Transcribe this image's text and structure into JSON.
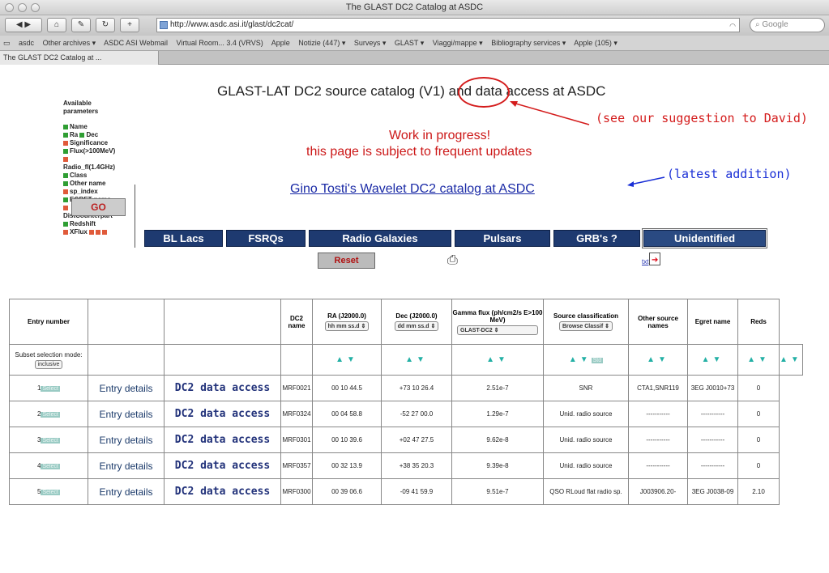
{
  "browser": {
    "window_title": "The GLAST DC2 Catalog at ASDC",
    "url": "http://www.asdc.asi.it/glast/dc2cat/",
    "search_placeholder": "Google",
    "bookmarks": [
      "asdc",
      "Other archives ▾",
      "ASDC ASI Webmail",
      "Virtual Room... 3.4 (VRVS)",
      "Apple",
      "Notizie (447) ▾",
      "Surveys ▾",
      "GLAST ▾",
      "Viaggi/mappe ▾",
      "Bibliography services ▾",
      "Apple (105) ▾"
    ],
    "tab_title": "The GLAST DC2 Catalog at ..."
  },
  "page": {
    "heading": "GLAST-LAT DC2 source catalog (V1) and data access at ASDC",
    "wip_line1": "Work in progress!",
    "wip_line2": "this page is subject to frequent updates",
    "tosti_link": "Gino Tosti's Wavelet DC2 catalog at ASDC",
    "note_suggestion": "(see our suggestion to David)",
    "note_latest": "(latest addition)",
    "reset_label": "Reset",
    "txt_label": "txt",
    "go_label": "GO"
  },
  "params": {
    "title_line1": "Available",
    "title_line2": "parameters",
    "items": [
      {
        "label": "Name",
        "checked": true
      },
      {
        "label": "Ra",
        "checked": true,
        "label2": "Dec",
        "checked2": true
      },
      {
        "label": "Significance",
        "checked": false
      },
      {
        "label": "Flux(>100MeV)",
        "checked": true
      },
      {
        "label": "",
        "checked": false
      },
      {
        "label": "Radio_fl(1.4GHz)",
        "checked": null
      },
      {
        "label": "Class",
        "checked": true
      },
      {
        "label": "Other name",
        "checked": true
      },
      {
        "label": "sp_index",
        "checked": false
      },
      {
        "label": "EGRET name",
        "checked": true
      },
      {
        "label": "",
        "checked": false
      },
      {
        "label": "DistCounterpart",
        "checked": null
      },
      {
        "label": "Redshift",
        "checked": true
      },
      {
        "label": "XFlux",
        "checked": false
      }
    ]
  },
  "categories": [
    "BL Lacs",
    "FSRQs",
    "Radio Galaxies",
    "Pulsars",
    "GRB's ?",
    "Unidentified"
  ],
  "table": {
    "headers": [
      "Entry number",
      "",
      "",
      "DC2 name",
      "RA (J2000.0)",
      "Dec (J2000.0)",
      "Gamma flux (ph/cm2/s E>100 MeV)",
      "Source classification",
      "Other source names",
      "Egret name",
      "Reds"
    ],
    "ra_dropdown": "hh mm ss.d",
    "dec_dropdown": "dd mm ss.d",
    "flux_dropdown": "GLAST-DC2",
    "class_dropdown": "Browse Classif",
    "subset_label": "Subset selection mode:",
    "subset_value": "inclusive",
    "select_label": "Select",
    "std_label": "Std",
    "entry_details_label": "Entry details",
    "dc2_access_label": "DC2 data access",
    "rows": [
      {
        "num": "1",
        "name": "MRF0021",
        "ra": "00 10 44.5",
        "dec": "+73 10 26.4",
        "flux": "2.51e-7",
        "cls": "SNR",
        "other": "CTA1,SNR119",
        "egret": "3EG J0010+73",
        "z": "0"
      },
      {
        "num": "2",
        "name": "MRF0324",
        "ra": "00 04 58.8",
        "dec": "-52 27 00.0",
        "flux": "1.29e-7",
        "cls": "Unid. radio source",
        "other": "-----------",
        "egret": "-----------",
        "z": "0"
      },
      {
        "num": "3",
        "name": "MRF0301",
        "ra": "00 10 39.6",
        "dec": "+02 47 27.5",
        "flux": "9.62e-8",
        "cls": "Unid. radio source",
        "other": "-----------",
        "egret": "-----------",
        "z": "0"
      },
      {
        "num": "4",
        "name": "MRF0357",
        "ra": "00 32 13.9",
        "dec": "+38 35 20.3",
        "flux": "9.39e-8",
        "cls": "Unid. radio source",
        "other": "-----------",
        "egret": "-----------",
        "z": "0"
      },
      {
        "num": "5",
        "name": "MRF0300",
        "ra": "00 39 06.6",
        "dec": "-09 41 59.9",
        "flux": "9.51e-7",
        "cls": "QSO RLoud flat radio sp.",
        "other": "J003906.20-",
        "egret": "3EG J0038-09",
        "z": "2.10"
      }
    ]
  }
}
